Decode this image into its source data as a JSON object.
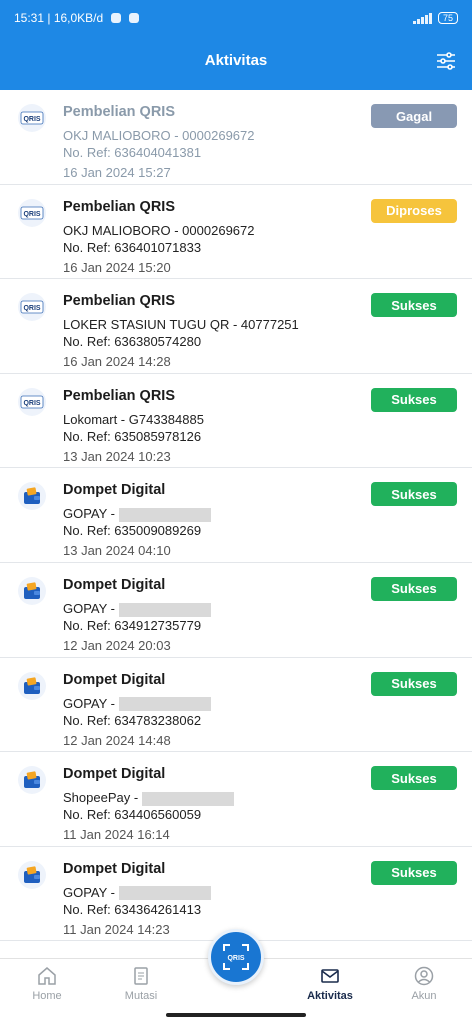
{
  "status_bar": {
    "time_speed": "15:31 | 16,0KB/d",
    "battery": "75"
  },
  "header": {
    "title": "Aktivitas"
  },
  "colors": {
    "primary": "#1e88e5",
    "sukses": "#21b15c",
    "diproses": "#f6c43c",
    "gagal": "#8899b3"
  },
  "activities": [
    {
      "title": "Pembelian QRIS",
      "merchant": "OKJ MALIOBORO - 0000269672",
      "ref": "No. Ref: 636404041381",
      "date": "16 Jan 2024 15:27",
      "status": "Gagal",
      "icon": "qris-icon"
    },
    {
      "title": "Pembelian QRIS",
      "merchant": "OKJ MALIOBORO - 0000269672",
      "ref": "No. Ref: 636401071833",
      "date": "16 Jan 2024 15:20",
      "status": "Diproses",
      "icon": "qris-icon"
    },
    {
      "title": "Pembelian QRIS",
      "merchant": "LOKER STASIUN TUGU QR - 40777251",
      "ref": "No. Ref: 636380574280",
      "date": "16 Jan 2024 14:28",
      "status": "Sukses",
      "icon": "qris-icon"
    },
    {
      "title": "Pembelian QRIS",
      "merchant": "Lokomart - G743384885",
      "ref": "No. Ref: 635085978126",
      "date": "13 Jan 2024 10:23",
      "status": "Sukses",
      "icon": "qris-icon"
    },
    {
      "title": "Dompet Digital",
      "merchant": "GOPAY -",
      "ref": "No. Ref: 635009089269",
      "date": "13 Jan 2024 04:10",
      "status": "Sukses",
      "icon": "wallet-icon"
    },
    {
      "title": "Dompet Digital",
      "merchant": "GOPAY -",
      "ref": "No. Ref: 634912735779",
      "date": "12 Jan 2024 20:03",
      "status": "Sukses",
      "icon": "wallet-icon"
    },
    {
      "title": "Dompet Digital",
      "merchant": "GOPAY -",
      "ref": "No. Ref: 634783238062",
      "date": "12 Jan 2024 14:48",
      "status": "Sukses",
      "icon": "wallet-icon"
    },
    {
      "title": "Dompet Digital",
      "merchant": "ShopeePay -",
      "ref": "No. Ref: 634406560059",
      "date": "11 Jan 2024 16:14",
      "status": "Sukses",
      "icon": "wallet-icon"
    },
    {
      "title": "Dompet Digital",
      "merchant": "GOPAY -",
      "ref": "No. Ref: 634364261413",
      "date": "11 Jan 2024 14:23",
      "status": "Sukses",
      "icon": "wallet-icon"
    }
  ],
  "nav": {
    "home": "Home",
    "mutasi": "Mutasi",
    "aktivitas": "Aktivitas",
    "akun": "Akun"
  }
}
